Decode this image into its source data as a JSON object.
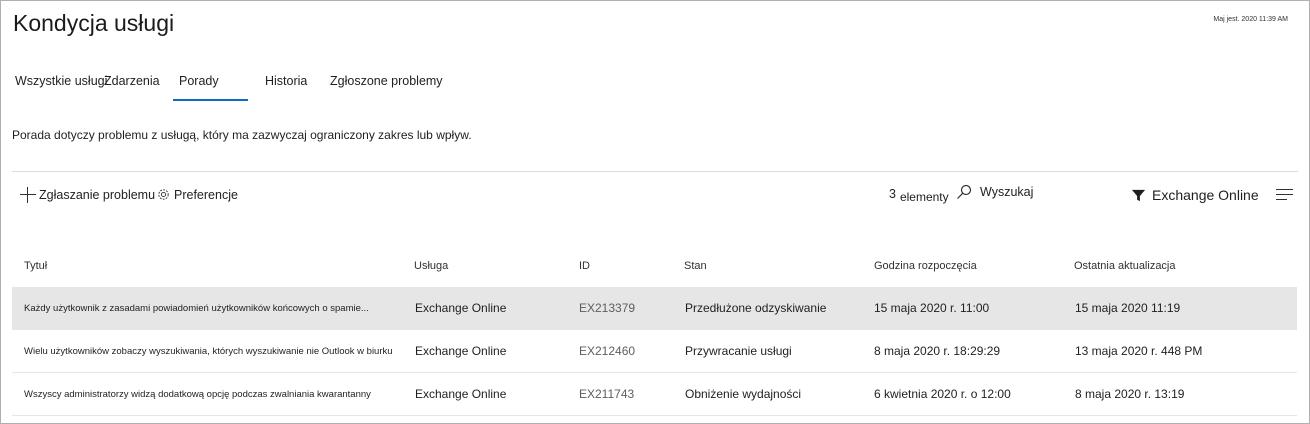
{
  "page": {
    "title": "Kondycja usługi",
    "timestamp": "Maj jest. 2020 11:39 AM"
  },
  "tabs": [
    {
      "label": "Wszystkie usługi"
    },
    {
      "label": "Zdarzenia"
    },
    {
      "label": "Porady"
    },
    {
      "label": "Historia"
    },
    {
      "label": "Zgłoszone problemy"
    }
  ],
  "description": "Porada dotyczy problemu z usługą, który ma zazwyczaj ograniczony zakres lub wpływ.",
  "toolbar": {
    "report_label": "Zgłaszanie problemu",
    "preferences_label": "Preferencje",
    "count_number": "3",
    "count_word": "elementy",
    "search_placeholder": "Wyszukaj",
    "filter_label": "Exchange Online"
  },
  "table": {
    "columns": [
      "Tytuł",
      "Usługa",
      "ID",
      "Stan",
      "Godzina rozpoczęcia",
      "Ostatnia aktualizacja"
    ],
    "rows": [
      {
        "title": "Każdy użytkownik z zasadami powiadomień użytkowników końcowych o spamie...",
        "service": "Exchange Online",
        "id": "EX213379",
        "status": "Przedłużone odzyskiwanie",
        "start": "15 maja 2020 r. 11:00",
        "updated": "15 maja 2020 11:19"
      },
      {
        "title": "Wielu użytkowników zobaczy wyszukiwania, których wyszukiwanie nie Outlook w biurku",
        "service": "Exchange Online",
        "id": "EX212460",
        "status": "Przywracanie usługi",
        "start": "8 maja 2020 r. 18:29:29",
        "updated": "13 maja 2020 r. 448 PM"
      },
      {
        "title": "Wszyscy administratorzy widzą dodatkową opcję podczas zwalniania kwarantanny",
        "service": "Exchange Online",
        "id": "EX211743",
        "status": "Obniżenie wydajności",
        "start": "6 kwietnia 2020 r. o 12:00",
        "updated": "8 maja 2020 r. 13:19"
      }
    ]
  },
  "colors": {
    "accent": "#0f6cbd",
    "selected_row": "#e6e6e6"
  }
}
